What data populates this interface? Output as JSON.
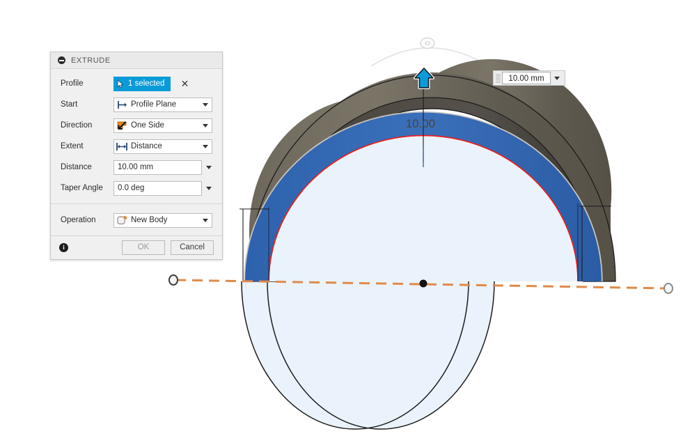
{
  "dialog": {
    "title": "EXTRUDE",
    "collapse_icon": "collapse-minus-icon",
    "rows": [
      {
        "key": "profile",
        "label": "Profile",
        "value": "1 selected",
        "icon": "cursor-arrow-icon",
        "type": "selection"
      },
      {
        "key": "start",
        "label": "Start",
        "value": "Profile Plane",
        "icon": "profile-plane-icon",
        "type": "dropdown"
      },
      {
        "key": "direction",
        "label": "Direction",
        "value": "One Side",
        "icon": "one-side-arrow-icon",
        "type": "dropdown"
      },
      {
        "key": "extent",
        "label": "Extent",
        "value": "Distance",
        "icon": "distance-arrows-icon",
        "type": "dropdown"
      },
      {
        "key": "distance",
        "label": "Distance",
        "value": "10.00 mm",
        "icon": "",
        "type": "entry"
      },
      {
        "key": "taper",
        "label": "Taper Angle",
        "value": "0.0 deg",
        "icon": "",
        "type": "entry"
      },
      {
        "key": "operation",
        "label": "Operation",
        "value": "New Body",
        "icon": "new-body-icon",
        "type": "dropdown"
      }
    ],
    "clear_selection_label": "✕",
    "footer": {
      "info_label": "i",
      "ok_label": "OK",
      "cancel_label": "Cancel"
    }
  },
  "canvas": {
    "value_input": {
      "value": "10.00 mm",
      "placeholder": "10.00 mm",
      "dropdown_icon": "chevron-down-icon",
      "grip_icon": "drag-grip-icon"
    },
    "dimension_label": "10.00",
    "direction_handle_icon": "extrude-arrow-up-icon",
    "rotate_handle_icon": "rotate-handle-icon",
    "axis_icon": "construction-axis-line",
    "origin_point_icon": "origin-point"
  },
  "colors": {
    "accent_blue": "#0b9bd8",
    "selected_face_blue": "#2f64ae",
    "profile_edge_red": "#f01c1c",
    "axis_orange": "#e08a4a",
    "body_gray_light": "#6f6a5f",
    "body_gray_dark": "#4f4b45",
    "sketch_fill": "#eaf3fb",
    "highlight_silver": "#c8c6c2"
  }
}
